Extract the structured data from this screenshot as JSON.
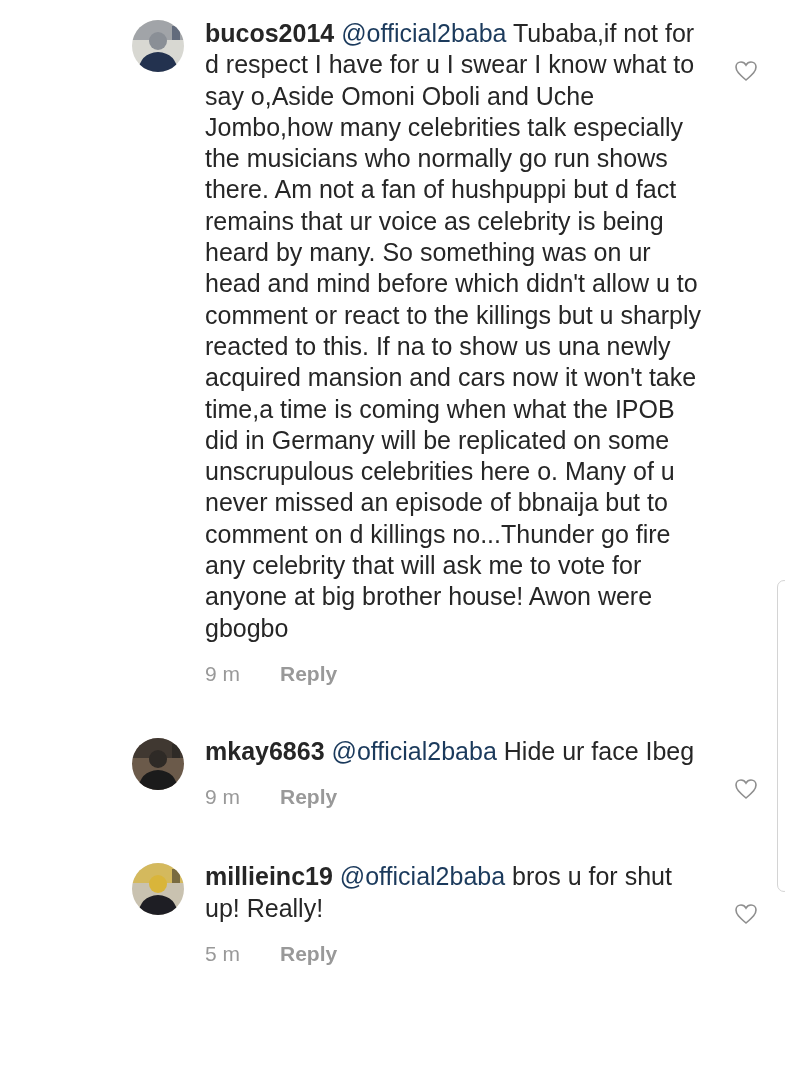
{
  "comments": [
    {
      "username": "bucos2014",
      "mention": "@official2baba",
      "text": "Tubaba,if not for d respect I have for u I swear I know what to say o,Aside Omoni Oboli and Uche Jombo,how many celebrities talk especially the musicians who normally go run shows there. Am not a fan of hushpuppi but d fact remains that ur voice as celebrity is being heard by many. So something was on ur head and mind before which didn't allow u to comment or react to the killings but u sharply reacted to this. If na to show us una newly acquired mansion and cars now it won't take time,a time is coming when what the IPOB did in Germany will be replicated on some unscrupulous celebrities here o. Many of u never missed an episode of bbnaija but to comment on d killings no...Thunder go fire any celebrity that will ask me to vote for anyone at big brother house! Awon were gbogbo",
      "time": "9 m",
      "reply": "Reply"
    },
    {
      "username": "mkay6863",
      "mention": "@official2baba",
      "text": "Hide ur face Ibeg",
      "time": "9 m",
      "reply": "Reply"
    },
    {
      "username": "millieinc19",
      "mention": "@official2baba",
      "text": "bros u for shut up! Really!",
      "time": "5 m",
      "reply": "Reply"
    }
  ]
}
